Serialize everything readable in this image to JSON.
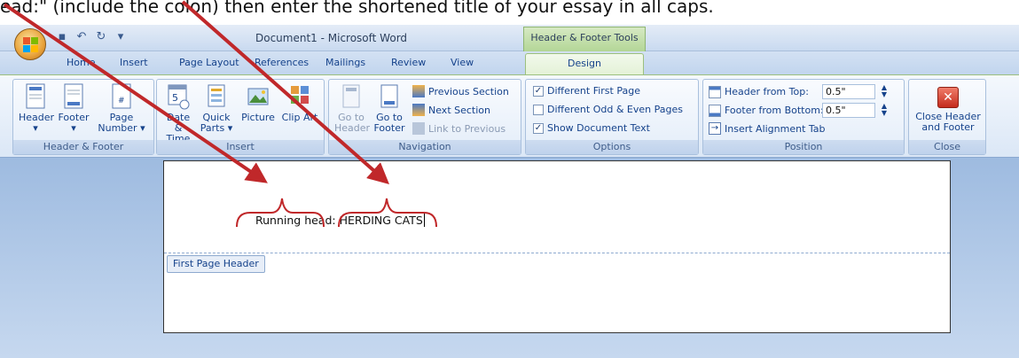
{
  "caption": "ead:\" (include the colon) then enter the shortened title of your essay in all caps.",
  "window": {
    "title": "Document1 - Microsoft Word",
    "tools_tab": "Header & Footer Tools"
  },
  "tabs": [
    "Home",
    "Insert",
    "Page Layout",
    "References",
    "Mailings",
    "Review",
    "View",
    "Design"
  ],
  "groups": {
    "header_footer": {
      "label": "Header & Footer",
      "buttons": [
        "Header",
        "Footer",
        "Page Number"
      ]
    },
    "insert": {
      "label": "Insert",
      "buttons": [
        "Date & Time",
        "Quick Parts",
        "Picture",
        "Clip Art"
      ]
    },
    "navigation": {
      "label": "Navigation",
      "buttons": [
        "Go to Header",
        "Go to Footer"
      ],
      "small": [
        "Previous Section",
        "Next Section",
        "Link to Previous"
      ]
    },
    "options": {
      "label": "Options",
      "checkboxes": [
        {
          "label": "Different First Page",
          "checked": true
        },
        {
          "label": "Different Odd & Even Pages",
          "checked": false
        },
        {
          "label": "Show Document Text",
          "checked": true
        }
      ]
    },
    "position": {
      "label": "Position",
      "header_from_top_label": "Header from Top:",
      "header_from_top": "0.5\"",
      "footer_from_bottom_label": "Footer from Bottom:",
      "footer_from_bottom": "0.5\"",
      "insert_tab": "Insert Alignment Tab"
    },
    "close": {
      "label": "Close",
      "button": "Close Header and Footer"
    }
  },
  "document": {
    "running_head_label": "Running head:",
    "title": "HERDING CATS",
    "header_label": "First Page Header"
  },
  "colors": {
    "arrow": "#c0282a",
    "brace": "#c0282a"
  }
}
